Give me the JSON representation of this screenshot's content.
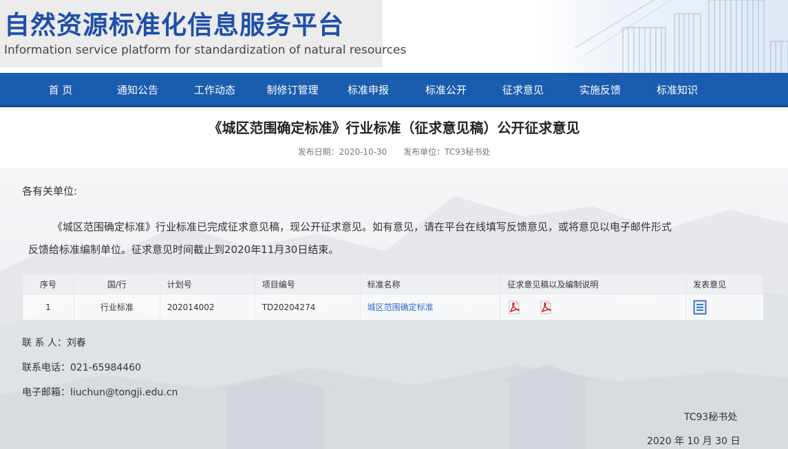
{
  "header": {
    "title_cn": "自然资源标准化信息服务平台",
    "title_en": "Information service platform for standardization of natural resources"
  },
  "nav": {
    "items": [
      "首 页",
      "通知公告",
      "工作动态",
      "制修订管理",
      "标准申报",
      "标准公开",
      "征求意见",
      "实施反馈",
      "标准知识"
    ]
  },
  "article": {
    "title": "《城区范围确定标准》行业标准（征求意见稿）公开征求意见",
    "date_text": "发布日期：2020-10-30",
    "unit_text": "发布单位：TC93秘书处",
    "greeting": "各有关单位:",
    "body_line1": "《城区范围确定标准》行业标准已完成征求意见稿，现公开征求意见。如有意见，请在平台在线填写反馈意见，或将意见以电子邮件形式",
    "body_line2": "反馈给标准编制单位。征求意见时间截止到2020年11月30日结束。"
  },
  "table": {
    "headers": [
      "序号",
      "国/行",
      "计划号",
      "项目编号",
      "标准名称",
      "征求意见稿以及编制说明",
      "发表意见"
    ],
    "rows": [
      {
        "index": "1",
        "level": "行业标准",
        "plan_no": "202014002",
        "project_no": "TD20204274",
        "standard_name": "城区范围确定标准"
      }
    ]
  },
  "contact": {
    "person": "联  系  人：刘春",
    "phone": "联系电话：021-65984460",
    "email": "电子邮箱：liuchun@tongji.edu.cn"
  },
  "signature": {
    "org": "TC93秘书处",
    "date": "2020 年 10 月 30 日"
  },
  "colors": {
    "nav_bg": "#1a5cae",
    "title_blue": "#1f4fa8",
    "link_blue": "#2a6bc7",
    "pdf_red": "#d9261c"
  },
  "icons": {
    "attachment": "pdf-icon",
    "feedback": "document-icon"
  }
}
